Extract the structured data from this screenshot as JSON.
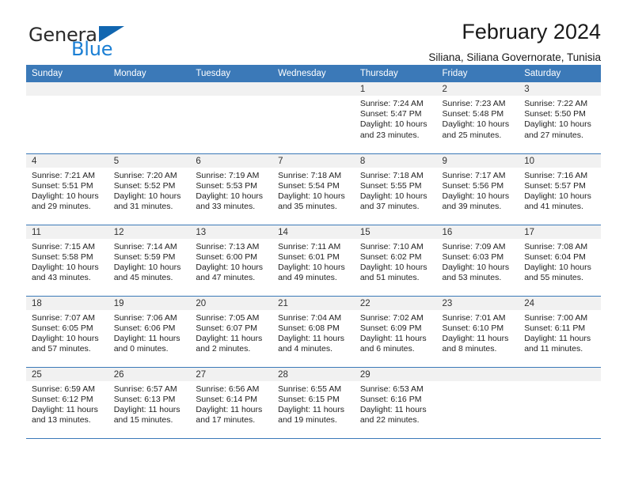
{
  "brand": {
    "name_primary": "General",
    "name_secondary": "Blue",
    "accent_color": "#1b7fd4",
    "triangle_color": "#1166b0"
  },
  "header": {
    "title": "February 2024",
    "subtitle": "Siliana, Siliana Governorate, Tunisia"
  },
  "calendar": {
    "header_bg": "#3b79b8",
    "weekday_headers": [
      "Sunday",
      "Monday",
      "Tuesday",
      "Wednesday",
      "Thursday",
      "Friday",
      "Saturday"
    ],
    "weeks": [
      [
        {
          "day": "",
          "empty": true
        },
        {
          "day": "",
          "empty": true
        },
        {
          "day": "",
          "empty": true
        },
        {
          "day": "",
          "empty": true
        },
        {
          "day": "1",
          "sunrise": "Sunrise: 7:24 AM",
          "sunset": "Sunset: 5:47 PM",
          "daylight": "Daylight: 10 hours and 23 minutes."
        },
        {
          "day": "2",
          "sunrise": "Sunrise: 7:23 AM",
          "sunset": "Sunset: 5:48 PM",
          "daylight": "Daylight: 10 hours and 25 minutes."
        },
        {
          "day": "3",
          "sunrise": "Sunrise: 7:22 AM",
          "sunset": "Sunset: 5:50 PM",
          "daylight": "Daylight: 10 hours and 27 minutes."
        }
      ],
      [
        {
          "day": "4",
          "sunrise": "Sunrise: 7:21 AM",
          "sunset": "Sunset: 5:51 PM",
          "daylight": "Daylight: 10 hours and 29 minutes."
        },
        {
          "day": "5",
          "sunrise": "Sunrise: 7:20 AM",
          "sunset": "Sunset: 5:52 PM",
          "daylight": "Daylight: 10 hours and 31 minutes."
        },
        {
          "day": "6",
          "sunrise": "Sunrise: 7:19 AM",
          "sunset": "Sunset: 5:53 PM",
          "daylight": "Daylight: 10 hours and 33 minutes."
        },
        {
          "day": "7",
          "sunrise": "Sunrise: 7:18 AM",
          "sunset": "Sunset: 5:54 PM",
          "daylight": "Daylight: 10 hours and 35 minutes."
        },
        {
          "day": "8",
          "sunrise": "Sunrise: 7:18 AM",
          "sunset": "Sunset: 5:55 PM",
          "daylight": "Daylight: 10 hours and 37 minutes."
        },
        {
          "day": "9",
          "sunrise": "Sunrise: 7:17 AM",
          "sunset": "Sunset: 5:56 PM",
          "daylight": "Daylight: 10 hours and 39 minutes."
        },
        {
          "day": "10",
          "sunrise": "Sunrise: 7:16 AM",
          "sunset": "Sunset: 5:57 PM",
          "daylight": "Daylight: 10 hours and 41 minutes."
        }
      ],
      [
        {
          "day": "11",
          "sunrise": "Sunrise: 7:15 AM",
          "sunset": "Sunset: 5:58 PM",
          "daylight": "Daylight: 10 hours and 43 minutes."
        },
        {
          "day": "12",
          "sunrise": "Sunrise: 7:14 AM",
          "sunset": "Sunset: 5:59 PM",
          "daylight": "Daylight: 10 hours and 45 minutes."
        },
        {
          "day": "13",
          "sunrise": "Sunrise: 7:13 AM",
          "sunset": "Sunset: 6:00 PM",
          "daylight": "Daylight: 10 hours and 47 minutes."
        },
        {
          "day": "14",
          "sunrise": "Sunrise: 7:11 AM",
          "sunset": "Sunset: 6:01 PM",
          "daylight": "Daylight: 10 hours and 49 minutes."
        },
        {
          "day": "15",
          "sunrise": "Sunrise: 7:10 AM",
          "sunset": "Sunset: 6:02 PM",
          "daylight": "Daylight: 10 hours and 51 minutes."
        },
        {
          "day": "16",
          "sunrise": "Sunrise: 7:09 AM",
          "sunset": "Sunset: 6:03 PM",
          "daylight": "Daylight: 10 hours and 53 minutes."
        },
        {
          "day": "17",
          "sunrise": "Sunrise: 7:08 AM",
          "sunset": "Sunset: 6:04 PM",
          "daylight": "Daylight: 10 hours and 55 minutes."
        }
      ],
      [
        {
          "day": "18",
          "sunrise": "Sunrise: 7:07 AM",
          "sunset": "Sunset: 6:05 PM",
          "daylight": "Daylight: 10 hours and 57 minutes."
        },
        {
          "day": "19",
          "sunrise": "Sunrise: 7:06 AM",
          "sunset": "Sunset: 6:06 PM",
          "daylight": "Daylight: 11 hours and 0 minutes."
        },
        {
          "day": "20",
          "sunrise": "Sunrise: 7:05 AM",
          "sunset": "Sunset: 6:07 PM",
          "daylight": "Daylight: 11 hours and 2 minutes."
        },
        {
          "day": "21",
          "sunrise": "Sunrise: 7:04 AM",
          "sunset": "Sunset: 6:08 PM",
          "daylight": "Daylight: 11 hours and 4 minutes."
        },
        {
          "day": "22",
          "sunrise": "Sunrise: 7:02 AM",
          "sunset": "Sunset: 6:09 PM",
          "daylight": "Daylight: 11 hours and 6 minutes."
        },
        {
          "day": "23",
          "sunrise": "Sunrise: 7:01 AM",
          "sunset": "Sunset: 6:10 PM",
          "daylight": "Daylight: 11 hours and 8 minutes."
        },
        {
          "day": "24",
          "sunrise": "Sunrise: 7:00 AM",
          "sunset": "Sunset: 6:11 PM",
          "daylight": "Daylight: 11 hours and 11 minutes."
        }
      ],
      [
        {
          "day": "25",
          "sunrise": "Sunrise: 6:59 AM",
          "sunset": "Sunset: 6:12 PM",
          "daylight": "Daylight: 11 hours and 13 minutes."
        },
        {
          "day": "26",
          "sunrise": "Sunrise: 6:57 AM",
          "sunset": "Sunset: 6:13 PM",
          "daylight": "Daylight: 11 hours and 15 minutes."
        },
        {
          "day": "27",
          "sunrise": "Sunrise: 6:56 AM",
          "sunset": "Sunset: 6:14 PM",
          "daylight": "Daylight: 11 hours and 17 minutes."
        },
        {
          "day": "28",
          "sunrise": "Sunrise: 6:55 AM",
          "sunset": "Sunset: 6:15 PM",
          "daylight": "Daylight: 11 hours and 19 minutes."
        },
        {
          "day": "29",
          "sunrise": "Sunrise: 6:53 AM",
          "sunset": "Sunset: 6:16 PM",
          "daylight": "Daylight: 11 hours and 22 minutes."
        },
        {
          "day": "",
          "empty": true
        },
        {
          "day": "",
          "empty": true
        }
      ]
    ]
  }
}
